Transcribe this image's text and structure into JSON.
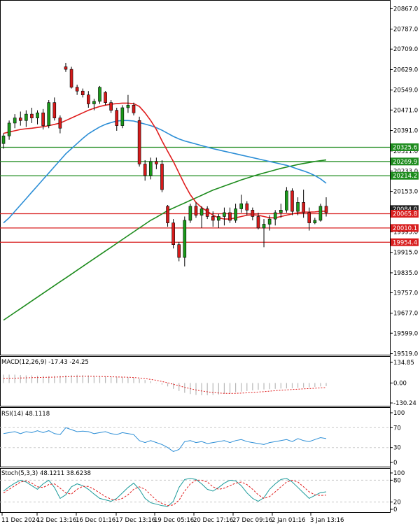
{
  "chart_data": [
    {
      "type": "candlestick",
      "name": "price",
      "y_ticks": [
        "20867.0",
        "20787.0",
        "20709.0",
        "20629.0",
        "20549.0",
        "20471.0",
        "20391.0",
        "20311.0",
        "20233.0",
        "20153.0",
        "20073.0",
        "19995.0",
        "19915.0",
        "19835.0",
        "19757.0",
        "19677.0",
        "19599.0",
        "19519.0"
      ],
      "ylim": [
        19515,
        20890
      ],
      "x_labels": [
        "11 Dec 2024",
        "12 Dec 13:16",
        "16 Dec 01:16",
        "17 Dec 13:16",
        "19 Dec 05:16",
        "20 Dec 17:16",
        "27 Dec 09:16",
        "2 Jan 01:16",
        "3 Jan 13:16"
      ],
      "price_tags": [
        {
          "label": "20325.6",
          "value": 20325.6,
          "color": "#1e8c1e"
        },
        {
          "label": "20269.9",
          "value": 20269.9,
          "color": "#1e8c1e"
        },
        {
          "label": "20214.2",
          "value": 20214.2,
          "color": "#1e8c1e"
        },
        {
          "label": "20084.0",
          "value": 20084.0,
          "color": "#222222"
        },
        {
          "label": "20065.8",
          "value": 20065.8,
          "color": "#d81e1e"
        },
        {
          "label": "20010.1",
          "value": 20010.1,
          "color": "#d81e1e"
        },
        {
          "label": "19954.4",
          "value": 19954.4,
          "color": "#d81e1e"
        }
      ],
      "horizontal_levels": [
        {
          "value": 20325.6,
          "color": "#1e8c1e"
        },
        {
          "value": 20269.9,
          "color": "#1e8c1e"
        },
        {
          "value": 20214.2,
          "color": "#1e8c1e"
        },
        {
          "value": 20065.8,
          "color": "#d81e1e"
        },
        {
          "value": 20010.1,
          "color": "#d81e1e"
        },
        {
          "value": 19954.4,
          "color": "#d81e1e"
        }
      ],
      "candles": [
        [
          20340,
          20380,
          20320,
          20370
        ],
        [
          20370,
          20430,
          20355,
          20420
        ],
        [
          20420,
          20455,
          20400,
          20440
        ],
        [
          20440,
          20465,
          20410,
          20430
        ],
        [
          20430,
          20470,
          20405,
          20455
        ],
        [
          20455,
          20480,
          20420,
          20440
        ],
        [
          20440,
          20470,
          20415,
          20460
        ],
        [
          20460,
          20475,
          20395,
          20410
        ],
        [
          20410,
          20510,
          20400,
          20500
        ],
        [
          20500,
          20520,
          20430,
          20440
        ],
        [
          20440,
          20450,
          20380,
          20400
        ],
        [
          20640,
          20655,
          20620,
          20630
        ],
        [
          20630,
          20640,
          20555,
          20560
        ],
        [
          20560,
          20570,
          20530,
          20545
        ],
        [
          20545,
          20555,
          20520,
          20530
        ],
        [
          20530,
          20545,
          20480,
          20495
        ],
        [
          20495,
          20515,
          20470,
          20505
        ],
        [
          20505,
          20565,
          20495,
          20560
        ],
        [
          20540,
          20545,
          20490,
          20500
        ],
        [
          20500,
          20510,
          20460,
          20470
        ],
        [
          20470,
          20480,
          20390,
          20410
        ],
        [
          20410,
          20490,
          20400,
          20480
        ],
        [
          20480,
          20530,
          20460,
          20490
        ],
        [
          20490,
          20500,
          20450,
          20460
        ],
        [
          20430,
          20445,
          20250,
          20260
        ],
        [
          20260,
          20275,
          20195,
          20215
        ],
        [
          20215,
          20285,
          20200,
          20270
        ],
        [
          20270,
          20285,
          20240,
          20260
        ],
        [
          20260,
          20275,
          20150,
          20160
        ],
        [
          20095,
          20100,
          20015,
          20030
        ],
        [
          20030,
          20045,
          19930,
          19945
        ],
        [
          19945,
          19955,
          19880,
          19895
        ],
        [
          19895,
          20055,
          19860,
          20040
        ],
        [
          20040,
          20105,
          20030,
          20095
        ],
        [
          20095,
          20110,
          20050,
          20060
        ],
        [
          20060,
          20095,
          20010,
          20085
        ],
        [
          20085,
          20095,
          20045,
          20055
        ],
        [
          20055,
          20075,
          20015,
          20040
        ],
        [
          20040,
          20065,
          20010,
          20055
        ],
        [
          20055,
          20090,
          20020,
          20070
        ],
        [
          20070,
          20090,
          20030,
          20040
        ],
        [
          20040,
          20105,
          20030,
          20085
        ],
        [
          20085,
          20140,
          20070,
          20105
        ],
        [
          20105,
          20115,
          20060,
          20080
        ],
        [
          20080,
          20090,
          20040,
          20055
        ],
        [
          20055,
          20070,
          20005,
          20010
        ],
        [
          20010,
          20045,
          19935,
          20025
        ],
        [
          20025,
          20060,
          20000,
          20045
        ],
        [
          20045,
          20080,
          20020,
          20070
        ],
        [
          20070,
          20105,
          20050,
          20080
        ],
        [
          20080,
          20170,
          20070,
          20155
        ],
        [
          20155,
          20165,
          20060,
          20075
        ],
        [
          20075,
          20130,
          20060,
          20110
        ],
        [
          20110,
          20160,
          20050,
          20070
        ],
        [
          20070,
          20090,
          20000,
          20030
        ],
        [
          20030,
          20050,
          20025,
          20040
        ],
        [
          20040,
          20105,
          20035,
          20095
        ],
        [
          20095,
          20130,
          20055,
          20070
        ]
      ],
      "ma_red": [
        20380,
        20385,
        20390,
        20395,
        20398,
        20400,
        20403,
        20406,
        20410,
        20415,
        20420,
        20430,
        20440,
        20450,
        20460,
        20470,
        20478,
        20485,
        20490,
        20494,
        20496,
        20498,
        20498,
        20496,
        20485,
        20460,
        20430,
        20395,
        20350,
        20310,
        20270,
        20225,
        20180,
        20140,
        20110,
        20090,
        20075,
        20060,
        20050,
        20045,
        20045,
        20050,
        20055,
        20060,
        20062,
        20060,
        20055,
        20050,
        20050,
        20055,
        20060,
        20065,
        20070,
        20072,
        20072,
        20073,
        20075,
        20076
      ],
      "ma_blue": [
        20030,
        20050,
        20075,
        20100,
        20125,
        20150,
        20175,
        20200,
        20225,
        20250,
        20275,
        20300,
        20320,
        20340,
        20360,
        20378,
        20392,
        20405,
        20415,
        20422,
        20428,
        20430,
        20430,
        20428,
        20422,
        20416,
        20410,
        20402,
        20392,
        20380,
        20368,
        20358,
        20350,
        20344,
        20338,
        20332,
        20326,
        20320,
        20315,
        20310,
        20305,
        20300,
        20295,
        20290,
        20285,
        20280,
        20275,
        20270,
        20265,
        20260,
        20255,
        20248,
        20240,
        20233,
        20225,
        20215,
        20202,
        20185
      ],
      "ma_green": [
        19650,
        19665,
        19680,
        19695,
        19710,
        19725,
        19740,
        19755,
        19770,
        19785,
        19800,
        19815,
        19830,
        19845,
        19860,
        19875,
        19890,
        19905,
        19920,
        19935,
        19950,
        19965,
        19980,
        19995,
        20010,
        20025,
        20040,
        20052,
        20065,
        20078,
        20088,
        20098,
        20108,
        20118,
        20128,
        20138,
        20148,
        20158,
        20166,
        20174,
        20182,
        20190,
        20198,
        20205,
        20212,
        20219,
        20225,
        20231,
        20237,
        20243,
        20248,
        20253,
        20258,
        20262,
        20266,
        20270,
        20273,
        20276
      ]
    },
    {
      "type": "histogram",
      "name": "macd",
      "title": "MACD(12,26,9) -17.43 -24.25",
      "y_ticks": [
        "134.85",
        "0.00",
        "-130.24"
      ],
      "ylim": [
        -130.24,
        134.85
      ],
      "values": [
        55,
        55,
        55,
        52,
        50,
        50,
        48,
        46,
        45,
        46,
        48,
        50,
        52,
        54,
        52,
        50,
        48,
        46,
        44,
        42,
        40,
        40,
        38,
        35,
        28,
        20,
        12,
        2,
        -10,
        -22,
        -38,
        -52,
        -64,
        -72,
        -78,
        -80,
        -80,
        -78,
        -75,
        -70,
        -66,
        -60,
        -56,
        -52,
        -48,
        -44,
        -42,
        -40,
        -38,
        -36,
        -35,
        -34,
        -32,
        -30,
        -28,
        -25,
        -22,
        -20
      ],
      "signal": [
        30,
        31,
        32,
        33,
        34,
        35,
        36,
        37,
        38,
        39,
        40,
        41,
        42,
        43,
        44,
        44,
        44,
        43,
        42,
        41,
        40,
        39,
        38,
        36,
        33,
        29,
        24,
        18,
        10,
        2,
        -8,
        -18,
        -28,
        -37,
        -45,
        -52,
        -57,
        -62,
        -65,
        -67,
        -68,
        -67,
        -66,
        -64,
        -62,
        -59,
        -56,
        -53,
        -50,
        -47,
        -45,
        -42,
        -40,
        -38,
        -36,
        -34,
        -32,
        -30
      ]
    },
    {
      "type": "line",
      "name": "rsi",
      "title": "RSI(14) 48.1118",
      "y_ticks": [
        "100",
        "70",
        "30",
        "0"
      ],
      "ylim": [
        0,
        100
      ],
      "values": [
        58,
        60,
        62,
        58,
        62,
        60,
        64,
        60,
        64,
        58,
        56,
        70,
        66,
        62,
        63,
        62,
        58,
        60,
        62,
        58,
        56,
        60,
        58,
        56,
        44,
        40,
        44,
        40,
        36,
        30,
        22,
        26,
        42,
        44,
        40,
        42,
        38,
        40,
        42,
        44,
        40,
        44,
        46,
        42,
        40,
        38,
        36,
        40,
        42,
        44,
        46,
        42,
        48,
        44,
        42,
        46,
        50,
        48
      ]
    },
    {
      "type": "line",
      "name": "stochastic",
      "title": "Stoch(5,3,3) 48.1211 38.6238",
      "y_ticks": [
        "100",
        "80",
        "20",
        "0"
      ],
      "ylim": [
        0,
        100
      ],
      "main": [
        50,
        62,
        72,
        80,
        75,
        65,
        55,
        70,
        80,
        60,
        30,
        40,
        62,
        70,
        65,
        55,
        42,
        30,
        26,
        22,
        30,
        45,
        60,
        72,
        55,
        30,
        18,
        14,
        10,
        8,
        22,
        60,
        82,
        85,
        82,
        70,
        55,
        50,
        60,
        72,
        80,
        78,
        65,
        45,
        30,
        22,
        32,
        55,
        70,
        82,
        85,
        75,
        60,
        45,
        30,
        38,
        46,
        48
      ],
      "signal": [
        45,
        55,
        65,
        75,
        78,
        72,
        62,
        60,
        68,
        70,
        58,
        45,
        42,
        55,
        63,
        63,
        55,
        45,
        35,
        28,
        25,
        30,
        40,
        55,
        62,
        55,
        40,
        25,
        16,
        10,
        12,
        25,
        50,
        70,
        80,
        80,
        75,
        62,
        55,
        58,
        65,
        72,
        75,
        68,
        55,
        40,
        30,
        35,
        48,
        62,
        75,
        80,
        75,
        62,
        48,
        40,
        38,
        39
      ]
    }
  ]
}
